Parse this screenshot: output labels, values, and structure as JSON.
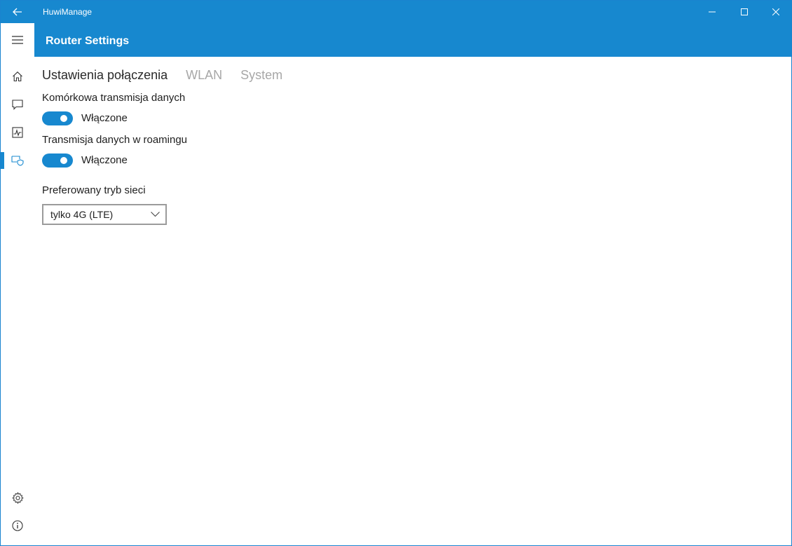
{
  "window": {
    "app_title": "HuwiManage"
  },
  "header": {
    "title": "Router Settings"
  },
  "rail": {
    "items": [
      {
        "icon": "home-icon"
      },
      {
        "icon": "message-icon"
      },
      {
        "icon": "activity-chart-icon"
      },
      {
        "icon": "router-shield-icon",
        "selected": true
      },
      {
        "icon": "gear-icon"
      },
      {
        "icon": "info-icon"
      }
    ]
  },
  "tabs": [
    {
      "label": "Ustawienia połączenia",
      "active": true
    },
    {
      "label": "WLAN",
      "active": false
    },
    {
      "label": "System",
      "active": false
    }
  ],
  "settings": {
    "mobile_data_label": "Komórkowa transmisja danych",
    "mobile_data_state": "Włączone",
    "roaming_label": "Transmisja danych w roamingu",
    "roaming_state": "Włączone",
    "network_mode_label": "Preferowany tryb sieci",
    "network_mode_value": "tylko 4G (LTE)"
  },
  "colors": {
    "accent": "#1788cf",
    "text": "#1e1e1e",
    "inactive_tab": "#a7a7a7"
  }
}
